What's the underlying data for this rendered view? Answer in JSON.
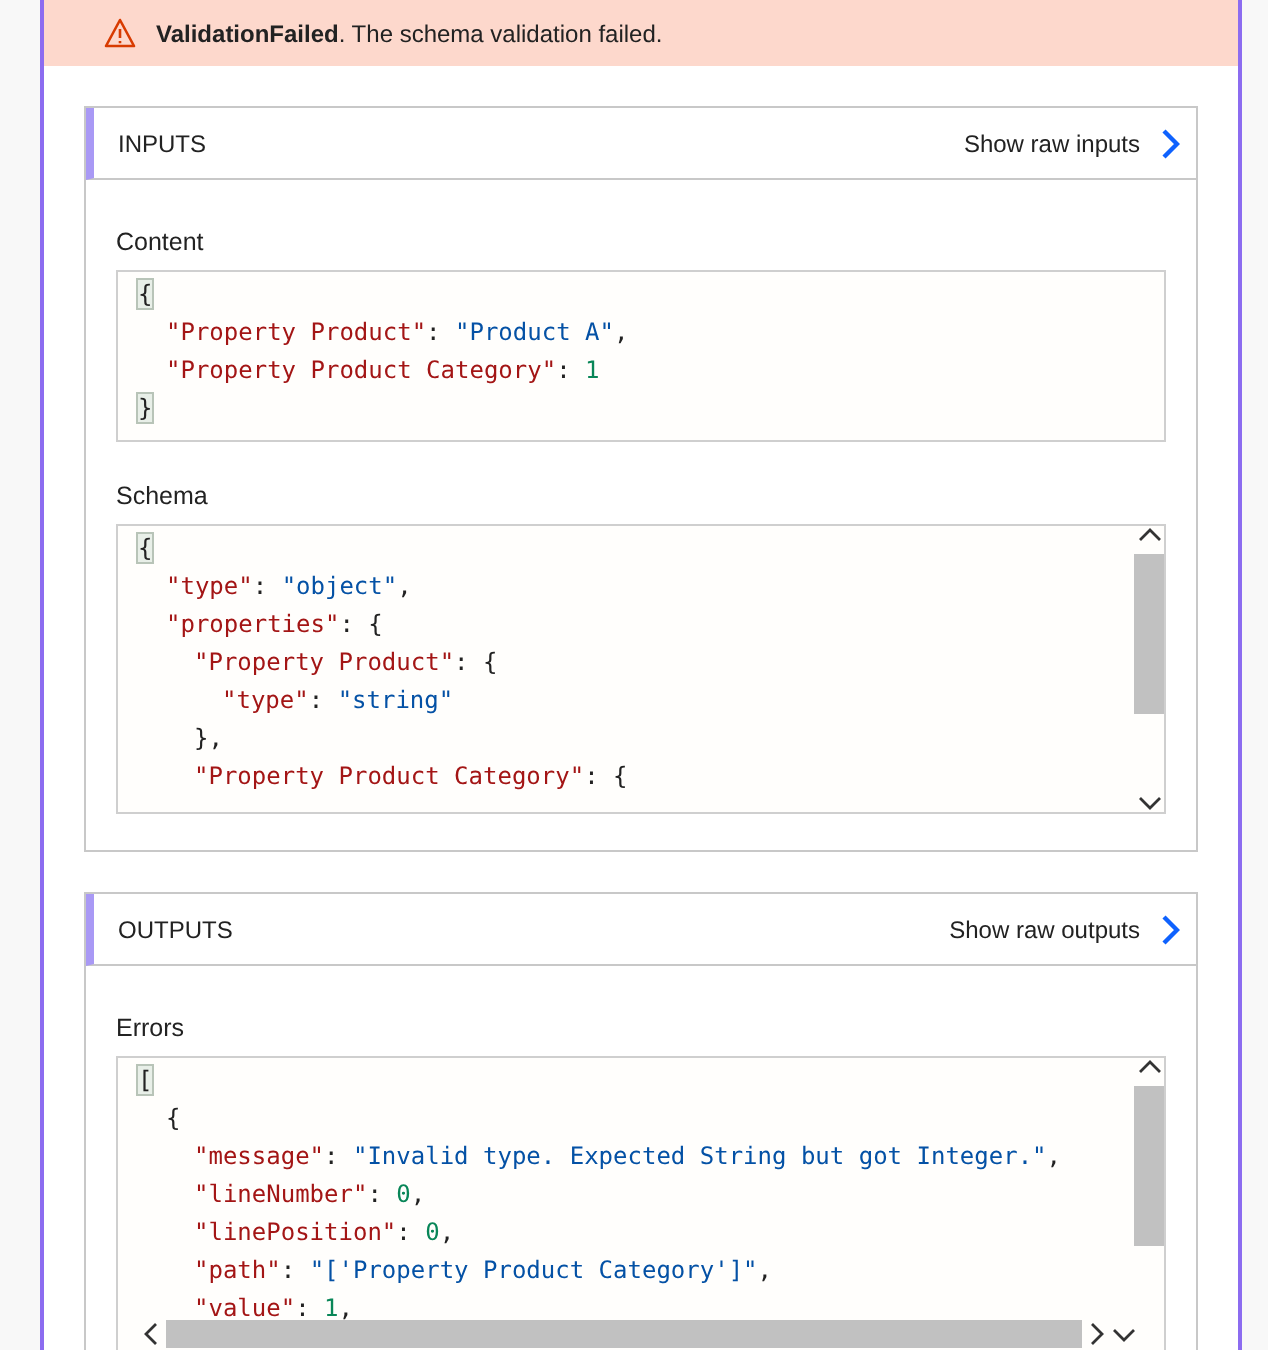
{
  "banner": {
    "title": "ValidationFailed",
    "message": ". The schema validation failed."
  },
  "sections": [
    {
      "title": "INPUTS",
      "link": "Show raw inputs",
      "fields": [
        {
          "label": "Content",
          "vertical_scrollbar": false,
          "horizontal_scrollbar": false,
          "lines": [
            {
              "tokens": [
                {
                  "kind": "bracket",
                  "text": "{"
                }
              ],
              "children": [
                {
                  "tokens": [
                    {
                      "kind": "key",
                      "text": "\"Property Product\""
                    },
                    {
                      "kind": "punct",
                      "text": ": "
                    },
                    {
                      "kind": "string",
                      "text": "\"Product A\""
                    },
                    {
                      "kind": "punct",
                      "text": ","
                    }
                  ]
                },
                {
                  "tokens": [
                    {
                      "kind": "key",
                      "text": "\"Property Product Category\""
                    },
                    {
                      "kind": "punct",
                      "text": ": "
                    },
                    {
                      "kind": "number",
                      "text": "1"
                    }
                  ]
                }
              ]
            },
            {
              "tokens": [
                {
                  "kind": "bracket",
                  "text": "}"
                }
              ]
            }
          ]
        },
        {
          "label": "Schema",
          "vertical_scrollbar": true,
          "horizontal_scrollbar": false,
          "lines": [
            {
              "tokens": [
                {
                  "kind": "bracket",
                  "text": "{"
                }
              ],
              "children": [
                {
                  "tokens": [
                    {
                      "kind": "key",
                      "text": "\"type\""
                    },
                    {
                      "kind": "punct",
                      "text": ": "
                    },
                    {
                      "kind": "string",
                      "text": "\"object\""
                    },
                    {
                      "kind": "punct",
                      "text": ","
                    }
                  ]
                },
                {
                  "tokens": [
                    {
                      "kind": "key",
                      "text": "\"properties\""
                    },
                    {
                      "kind": "punct",
                      "text": ": {"
                    }
                  ],
                  "children": [
                    {
                      "tokens": [
                        {
                          "kind": "key",
                          "text": "\"Property Product\""
                        },
                        {
                          "kind": "punct",
                          "text": ": {"
                        }
                      ],
                      "children": [
                        {
                          "tokens": [
                            {
                              "kind": "key",
                              "text": "\"type\""
                            },
                            {
                              "kind": "punct",
                              "text": ": "
                            },
                            {
                              "kind": "string",
                              "text": "\"string\""
                            }
                          ]
                        }
                      ]
                    },
                    {
                      "tokens": [
                        {
                          "kind": "punct",
                          "text": "},"
                        }
                      ]
                    },
                    {
                      "tokens": [
                        {
                          "kind": "key",
                          "text": "\"Property Product Category\""
                        },
                        {
                          "kind": "punct",
                          "text": ": {"
                        }
                      ]
                    }
                  ]
                }
              ]
            }
          ]
        }
      ]
    },
    {
      "title": "OUTPUTS",
      "link": "Show raw outputs",
      "fields": [
        {
          "label": "Errors",
          "vertical_scrollbar": true,
          "horizontal_scrollbar": true,
          "lines": [
            {
              "tokens": [
                {
                  "kind": "bracket",
                  "text": "["
                }
              ],
              "children": [
                {
                  "tokens": [
                    {
                      "kind": "punct",
                      "text": "{"
                    }
                  ],
                  "children": [
                    {
                      "tokens": [
                        {
                          "kind": "key",
                          "text": "\"message\""
                        },
                        {
                          "kind": "punct",
                          "text": ": "
                        },
                        {
                          "kind": "string",
                          "text": "\"Invalid type. Expected String but got Integer.\""
                        },
                        {
                          "kind": "punct",
                          "text": ","
                        }
                      ]
                    },
                    {
                      "tokens": [
                        {
                          "kind": "key",
                          "text": "\"lineNumber\""
                        },
                        {
                          "kind": "punct",
                          "text": ": "
                        },
                        {
                          "kind": "number",
                          "text": "0"
                        },
                        {
                          "kind": "punct",
                          "text": ","
                        }
                      ]
                    },
                    {
                      "tokens": [
                        {
                          "kind": "key",
                          "text": "\"linePosition\""
                        },
                        {
                          "kind": "punct",
                          "text": ": "
                        },
                        {
                          "kind": "number",
                          "text": "0"
                        },
                        {
                          "kind": "punct",
                          "text": ","
                        }
                      ]
                    },
                    {
                      "tokens": [
                        {
                          "kind": "key",
                          "text": "\"path\""
                        },
                        {
                          "kind": "punct",
                          "text": ": "
                        },
                        {
                          "kind": "string",
                          "text": "\"['Property Product Category']\""
                        },
                        {
                          "kind": "punct",
                          "text": ","
                        }
                      ]
                    },
                    {
                      "tokens": [
                        {
                          "kind": "key",
                          "text": "\"value\""
                        },
                        {
                          "kind": "punct",
                          "text": ": "
                        },
                        {
                          "kind": "number",
                          "text": "1"
                        },
                        {
                          "kind": "punct",
                          "text": ","
                        }
                      ]
                    }
                  ]
                }
              ]
            }
          ]
        }
      ]
    }
  ]
}
